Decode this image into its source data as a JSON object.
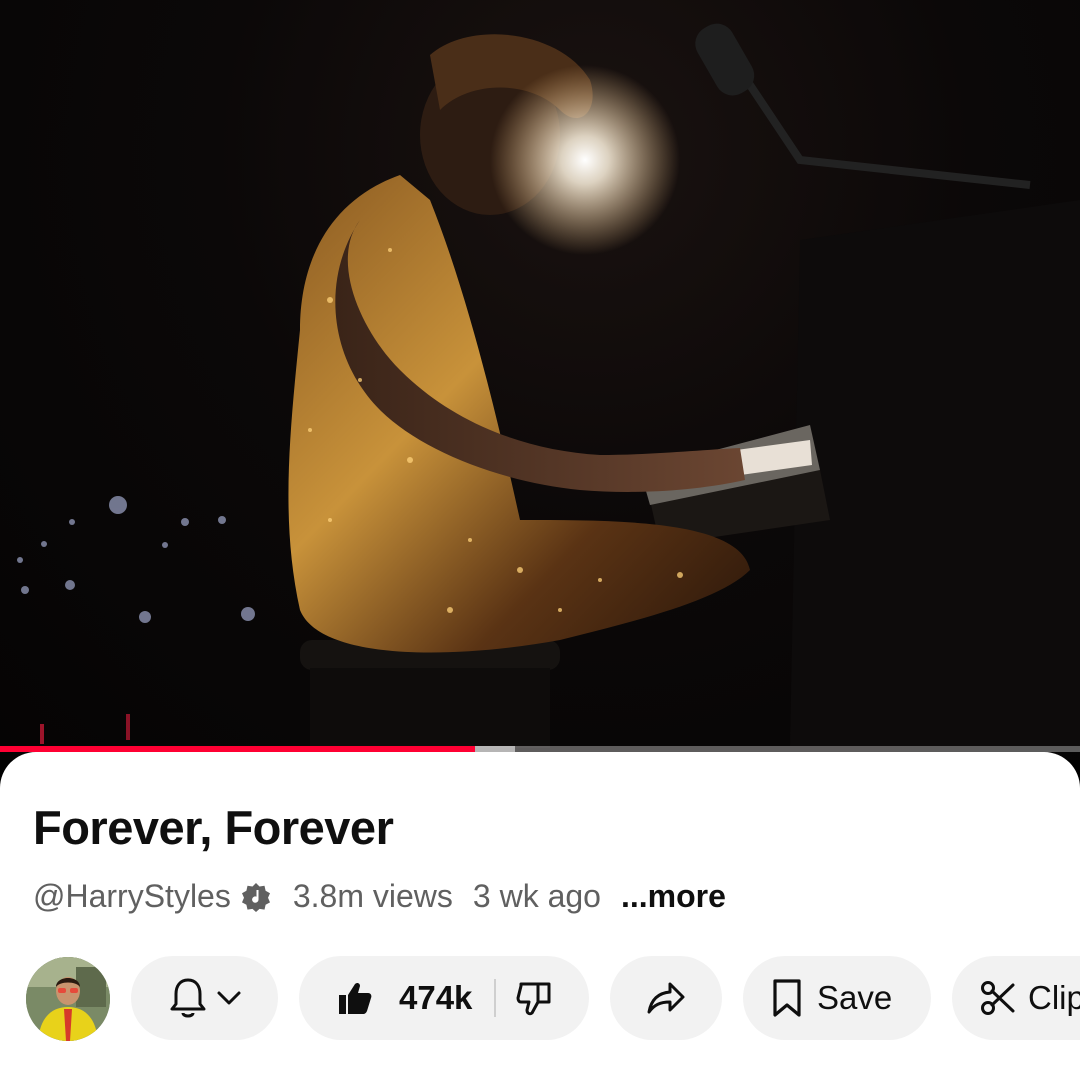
{
  "video": {
    "progress_fraction": 0.44,
    "accent_color": "#ff0033"
  },
  "info": {
    "title": "Forever, Forever",
    "channel_handle": "@HarryStyles",
    "verified_icon": "verified-music-icon",
    "views": "3.8m views",
    "ago": "3 wk ago",
    "more": "...more"
  },
  "actions": {
    "subscribe_icons": [
      "bell-icon",
      "chevron-down-icon"
    ],
    "like_count": "474k",
    "like_icon": "thumbs-up-icon",
    "dislike_icon": "thumbs-down-icon",
    "share_icon": "share-icon",
    "save_label": "Save",
    "save_icon": "bookmark-icon",
    "clip_label": "Clip",
    "clip_icon": "scissors-icon"
  }
}
